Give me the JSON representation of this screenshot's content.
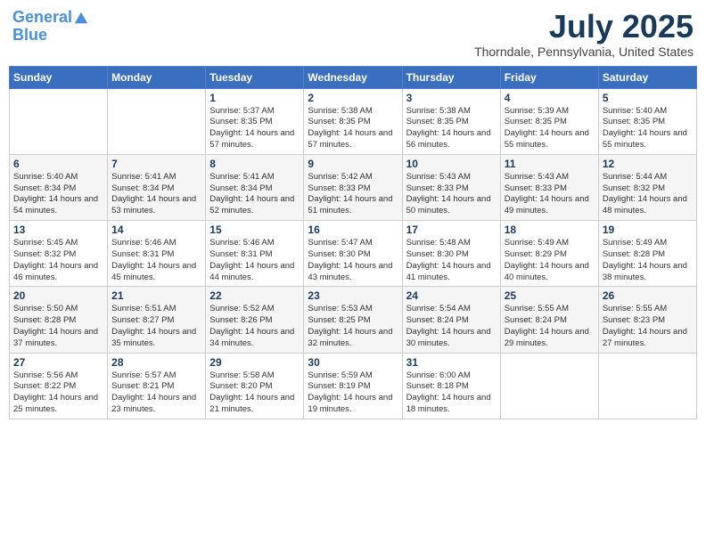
{
  "header": {
    "logo_line1": "General",
    "logo_line2": "Blue",
    "month_title": "July 2025",
    "location": "Thorndale, Pennsylvania, United States"
  },
  "days_of_week": [
    "Sunday",
    "Monday",
    "Tuesday",
    "Wednesday",
    "Thursday",
    "Friday",
    "Saturday"
  ],
  "weeks": [
    [
      {
        "day": "",
        "info": ""
      },
      {
        "day": "",
        "info": ""
      },
      {
        "day": "1",
        "info": "Sunrise: 5:37 AM\nSunset: 8:35 PM\nDaylight: 14 hours and 57 minutes."
      },
      {
        "day": "2",
        "info": "Sunrise: 5:38 AM\nSunset: 8:35 PM\nDaylight: 14 hours and 57 minutes."
      },
      {
        "day": "3",
        "info": "Sunrise: 5:38 AM\nSunset: 8:35 PM\nDaylight: 14 hours and 56 minutes."
      },
      {
        "day": "4",
        "info": "Sunrise: 5:39 AM\nSunset: 8:35 PM\nDaylight: 14 hours and 55 minutes."
      },
      {
        "day": "5",
        "info": "Sunrise: 5:40 AM\nSunset: 8:35 PM\nDaylight: 14 hours and 55 minutes."
      }
    ],
    [
      {
        "day": "6",
        "info": "Sunrise: 5:40 AM\nSunset: 8:34 PM\nDaylight: 14 hours and 54 minutes."
      },
      {
        "day": "7",
        "info": "Sunrise: 5:41 AM\nSunset: 8:34 PM\nDaylight: 14 hours and 53 minutes."
      },
      {
        "day": "8",
        "info": "Sunrise: 5:41 AM\nSunset: 8:34 PM\nDaylight: 14 hours and 52 minutes."
      },
      {
        "day": "9",
        "info": "Sunrise: 5:42 AM\nSunset: 8:33 PM\nDaylight: 14 hours and 51 minutes."
      },
      {
        "day": "10",
        "info": "Sunrise: 5:43 AM\nSunset: 8:33 PM\nDaylight: 14 hours and 50 minutes."
      },
      {
        "day": "11",
        "info": "Sunrise: 5:43 AM\nSunset: 8:33 PM\nDaylight: 14 hours and 49 minutes."
      },
      {
        "day": "12",
        "info": "Sunrise: 5:44 AM\nSunset: 8:32 PM\nDaylight: 14 hours and 48 minutes."
      }
    ],
    [
      {
        "day": "13",
        "info": "Sunrise: 5:45 AM\nSunset: 8:32 PM\nDaylight: 14 hours and 46 minutes."
      },
      {
        "day": "14",
        "info": "Sunrise: 5:46 AM\nSunset: 8:31 PM\nDaylight: 14 hours and 45 minutes."
      },
      {
        "day": "15",
        "info": "Sunrise: 5:46 AM\nSunset: 8:31 PM\nDaylight: 14 hours and 44 minutes."
      },
      {
        "day": "16",
        "info": "Sunrise: 5:47 AM\nSunset: 8:30 PM\nDaylight: 14 hours and 43 minutes."
      },
      {
        "day": "17",
        "info": "Sunrise: 5:48 AM\nSunset: 8:30 PM\nDaylight: 14 hours and 41 minutes."
      },
      {
        "day": "18",
        "info": "Sunrise: 5:49 AM\nSunset: 8:29 PM\nDaylight: 14 hours and 40 minutes."
      },
      {
        "day": "19",
        "info": "Sunrise: 5:49 AM\nSunset: 8:28 PM\nDaylight: 14 hours and 38 minutes."
      }
    ],
    [
      {
        "day": "20",
        "info": "Sunrise: 5:50 AM\nSunset: 8:28 PM\nDaylight: 14 hours and 37 minutes."
      },
      {
        "day": "21",
        "info": "Sunrise: 5:51 AM\nSunset: 8:27 PM\nDaylight: 14 hours and 35 minutes."
      },
      {
        "day": "22",
        "info": "Sunrise: 5:52 AM\nSunset: 8:26 PM\nDaylight: 14 hours and 34 minutes."
      },
      {
        "day": "23",
        "info": "Sunrise: 5:53 AM\nSunset: 8:25 PM\nDaylight: 14 hours and 32 minutes."
      },
      {
        "day": "24",
        "info": "Sunrise: 5:54 AM\nSunset: 8:24 PM\nDaylight: 14 hours and 30 minutes."
      },
      {
        "day": "25",
        "info": "Sunrise: 5:55 AM\nSunset: 8:24 PM\nDaylight: 14 hours and 29 minutes."
      },
      {
        "day": "26",
        "info": "Sunrise: 5:55 AM\nSunset: 8:23 PM\nDaylight: 14 hours and 27 minutes."
      }
    ],
    [
      {
        "day": "27",
        "info": "Sunrise: 5:56 AM\nSunset: 8:22 PM\nDaylight: 14 hours and 25 minutes."
      },
      {
        "day": "28",
        "info": "Sunrise: 5:57 AM\nSunset: 8:21 PM\nDaylight: 14 hours and 23 minutes."
      },
      {
        "day": "29",
        "info": "Sunrise: 5:58 AM\nSunset: 8:20 PM\nDaylight: 14 hours and 21 minutes."
      },
      {
        "day": "30",
        "info": "Sunrise: 5:59 AM\nSunset: 8:19 PM\nDaylight: 14 hours and 19 minutes."
      },
      {
        "day": "31",
        "info": "Sunrise: 6:00 AM\nSunset: 8:18 PM\nDaylight: 14 hours and 18 minutes."
      },
      {
        "day": "",
        "info": ""
      },
      {
        "day": "",
        "info": ""
      }
    ]
  ]
}
